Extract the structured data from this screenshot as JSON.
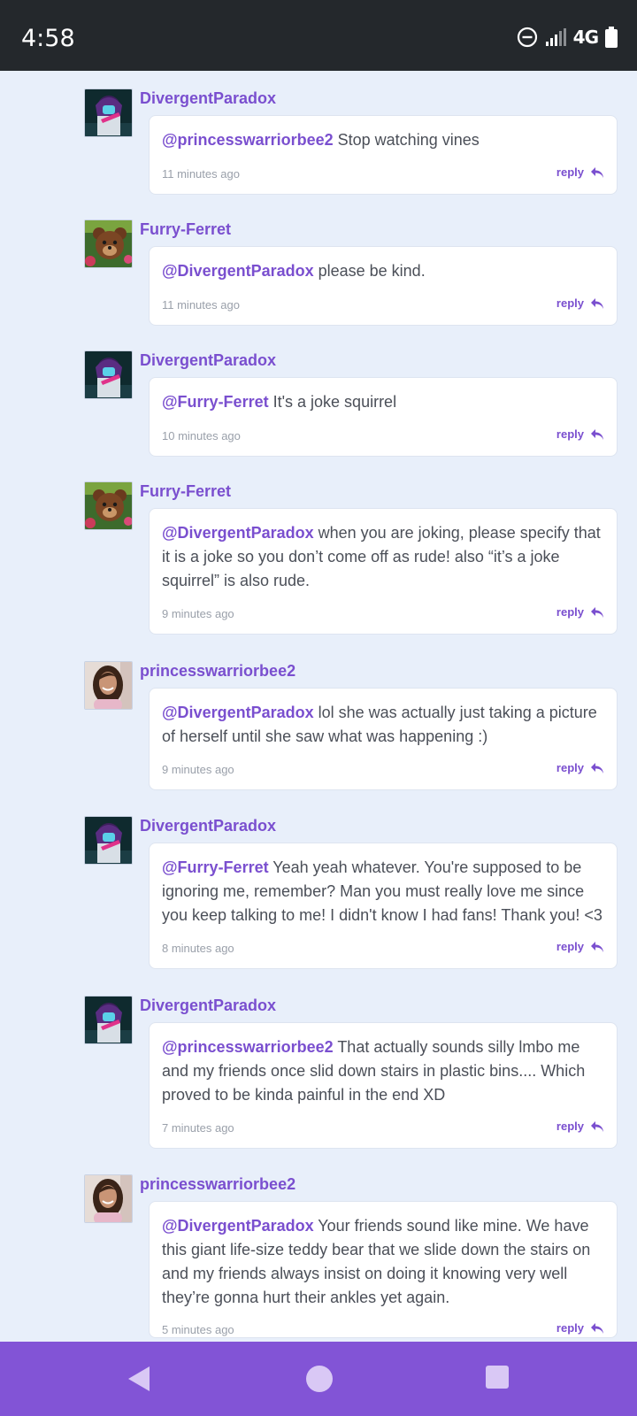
{
  "status_bar": {
    "time": "4:58",
    "network": "4G"
  },
  "comments": [
    {
      "author": "DivergentParadox",
      "avatar": "dp",
      "mention": "@princesswarriorbee2",
      "text": " Stop watching vines",
      "time": "11 minutes ago",
      "reply": "reply"
    },
    {
      "author": "Furry-Ferret",
      "avatar": "ff",
      "mention": "@DivergentParadox",
      "text": " please be kind.",
      "time": "11 minutes ago",
      "reply": "reply"
    },
    {
      "author": "DivergentParadox",
      "avatar": "dp",
      "mention": "@Furry-Ferret",
      "text": " It's a joke squirrel",
      "time": "10 minutes ago",
      "reply": "reply"
    },
    {
      "author": "Furry-Ferret",
      "avatar": "ff",
      "mention": "@DivergentParadox",
      "text": " when you are joking, please specify that it is a joke so you don’t come off as rude! also “it’s a joke squirrel” is also rude.",
      "time": "9 minutes ago",
      "reply": "reply"
    },
    {
      "author": "princesswarriorbee2",
      "avatar": "pw",
      "mention": "@DivergentParadox",
      "text": " lol she was actually just taking a picture of herself until she saw what was happening :)",
      "time": "9 minutes ago",
      "reply": "reply"
    },
    {
      "author": "DivergentParadox",
      "avatar": "dp",
      "mention": "@Furry-Ferret",
      "text": " Yeah yeah whatever. You're supposed to be ignoring me, remember? Man you must really love me since you keep talking to me! I didn't know I had fans! Thank you! <3",
      "time": "8 minutes ago",
      "reply": "reply"
    },
    {
      "author": "DivergentParadox",
      "avatar": "dp",
      "mention": "@princesswarriorbee2",
      "text": " That actually sounds silly lmbo me and my friends once slid down stairs in plastic bins.... Which proved to be kinda painful in the end XD",
      "time": "7 minutes ago",
      "reply": "reply"
    },
    {
      "author": "princesswarriorbee2",
      "avatar": "pw",
      "mention": "@DivergentParadox",
      "text": " Your friends sound like mine. We have this giant life-size teddy bear that we slide down the stairs on and my friends always insist on doing it knowing very well they’re gonna hurt their ankles yet again.",
      "time": "5 minutes ago",
      "reply": "reply"
    }
  ],
  "nav": {
    "back": "back-icon",
    "home": "home-icon",
    "recents": "recents-icon"
  },
  "colors": {
    "accent": "#7a4fcf",
    "nav": "#8254d6",
    "background": "#e8effa",
    "status_bar": "#24282c"
  }
}
